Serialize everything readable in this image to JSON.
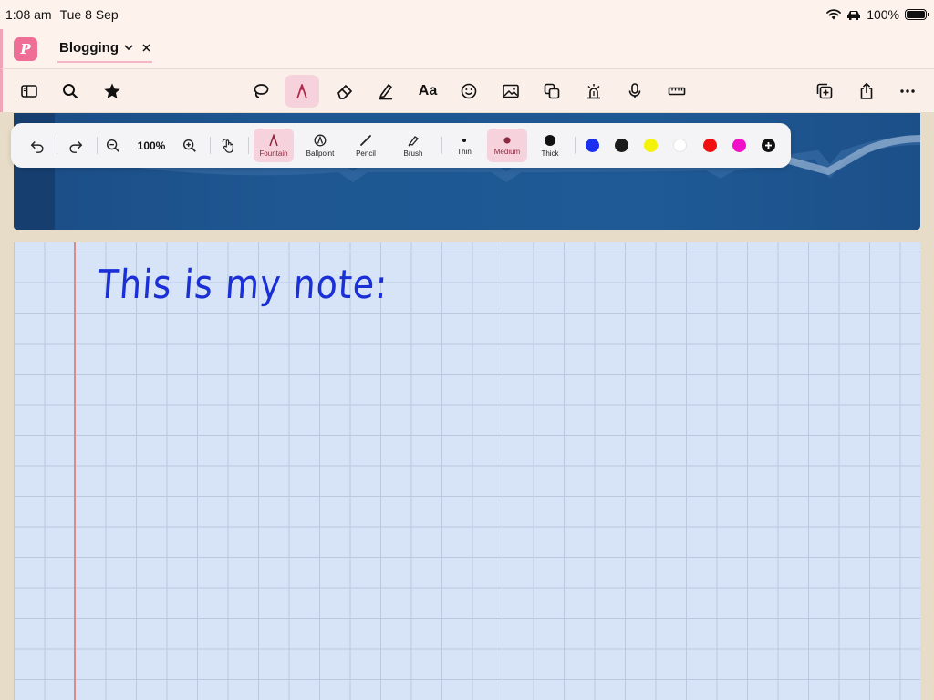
{
  "status": {
    "time": "1:08 am",
    "date": "Tue 8 Sep",
    "battery": "100%"
  },
  "tab": {
    "title": "Blogging"
  },
  "toolbar": {
    "text_tool_label": "Aa"
  },
  "pen_toolbar": {
    "zoom": "100%",
    "pens": [
      "Fountain",
      "Ballpoint",
      "Pencil",
      "Brush"
    ],
    "active_pen": "Fountain",
    "thickness": [
      "Thin",
      "Medium",
      "Thick"
    ],
    "active_thickness": "Medium",
    "colors": [
      "#1a2ff0",
      "#1b1b1b",
      "#f5f20a",
      "#ffffff",
      "#f20f0f",
      "#f011c8"
    ],
    "add_color_icon": "plus-circle-icon"
  },
  "note": {
    "text": "This is my note:",
    "ink_color": "#1a2fd6",
    "paper": "grid"
  },
  "theme": {
    "accent": "#ee6e95",
    "active_bg": "#f6d3dc"
  }
}
